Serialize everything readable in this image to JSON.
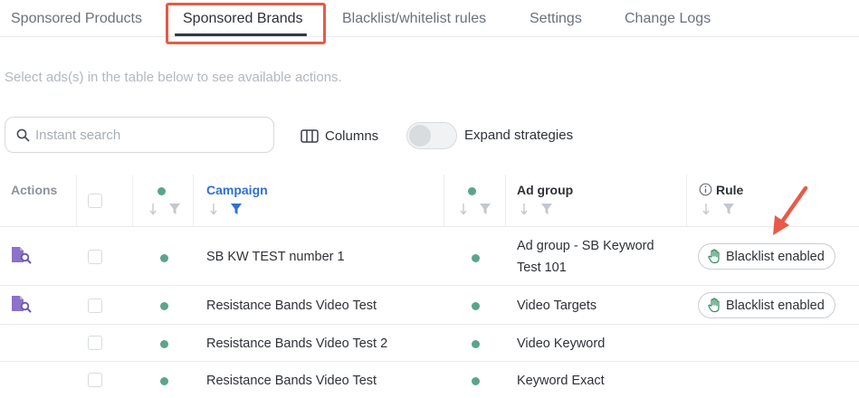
{
  "tabs": [
    {
      "label": "Sponsored Products"
    },
    {
      "label": "Sponsored Brands",
      "active": true
    },
    {
      "label": "Blacklist/whitelist rules"
    },
    {
      "label": "Settings"
    },
    {
      "label": "Change Logs"
    }
  ],
  "hint": "Select ads(s) in the table below to see available actions.",
  "search": {
    "placeholder": "Instant search",
    "value": ""
  },
  "toolbar": {
    "columns_label": "Columns",
    "expand_label": "Expand strategies",
    "expand_on": false
  },
  "table": {
    "headers": {
      "actions": "Actions",
      "campaign": "Campaign",
      "ad_group": "Ad group",
      "rule": "Rule"
    },
    "rows": [
      {
        "campaign": "SB KW TEST number 1",
        "ad_group": "Ad group - SB Keyword Test 101",
        "rule": "Blacklist enabled",
        "has_action": true
      },
      {
        "campaign": "Resistance Bands Video Test",
        "ad_group": "Video Targets",
        "rule": "Blacklist enabled",
        "has_action": true
      },
      {
        "campaign": "Resistance Bands Video Test 2",
        "ad_group": "Video Keyword",
        "rule": "",
        "has_action": false
      },
      {
        "campaign": "Resistance Bands Video Test",
        "ad_group": "Keyword Exact",
        "rule": "",
        "has_action": false
      }
    ]
  },
  "icons": {
    "search": "search-icon",
    "columns": "columns-icon",
    "sort": "sort-arrow-icon",
    "filter": "filter-icon",
    "info": "info-icon",
    "hand": "hand-icon",
    "action": "ad-inspect-icon",
    "status": "status-dot"
  },
  "colors": {
    "highlight": "#e85a47",
    "status_active": "#5aa58a",
    "campaign_header": "#2f6fd6",
    "action_icon": "#8a73c9"
  }
}
